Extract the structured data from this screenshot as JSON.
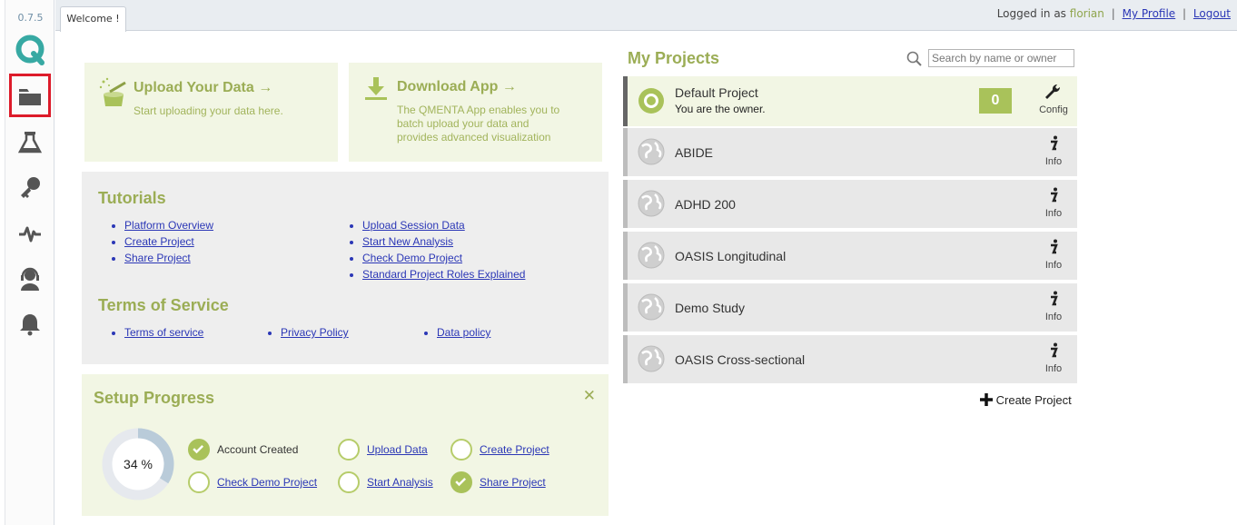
{
  "app": {
    "version": "0.7.5",
    "tab_label": "Welcome !",
    "accent": "#9bad55"
  },
  "userbar": {
    "logged_in_prefix": "Logged in as",
    "username": "florian",
    "my_profile": "My Profile",
    "logout": "Logout",
    "sep": "|"
  },
  "sidebar": {
    "items": [
      {
        "name": "projects",
        "icon": "folder-icon",
        "active": true
      },
      {
        "name": "analysis",
        "icon": "flask-icon"
      },
      {
        "name": "keys",
        "icon": "key-icon"
      },
      {
        "name": "activity",
        "icon": "pulse-icon"
      },
      {
        "name": "support",
        "icon": "headset-icon"
      },
      {
        "name": "notifications",
        "icon": "bell-icon"
      }
    ]
  },
  "upload": {
    "title": "Upload Your Data →",
    "subtitle": "Start uploading your data here."
  },
  "download": {
    "title": "Download App →",
    "lines": [
      "The QMENTA App enables you to",
      "batch upload your data and",
      "provides advanced visualization"
    ]
  },
  "tutorials": {
    "title": "Tutorials",
    "left": [
      "Platform Overview",
      "Create Project",
      "Share Project"
    ],
    "right": [
      "Upload Session Data",
      "Start New Analysis",
      "Check Demo Project",
      "Standard Project Roles Explained"
    ]
  },
  "terms": {
    "title": "Terms of Service",
    "links": [
      "Terms of service",
      "Privacy Policy",
      "Data policy"
    ]
  },
  "setup": {
    "title": "Setup Progress",
    "close": "✕",
    "progress": 34,
    "progress_label": "34 %",
    "items": [
      {
        "label": "Account Created",
        "done": true,
        "link": false
      },
      {
        "label": "Upload Data",
        "done": false,
        "link": true
      },
      {
        "label": "Create Project",
        "done": false,
        "link": true
      },
      {
        "label": "Check Demo Project",
        "done": false,
        "link": true
      },
      {
        "label": "Start Analysis",
        "done": false,
        "link": true
      },
      {
        "label": "Share Project",
        "done": true,
        "link": true
      }
    ]
  },
  "projects": {
    "title": "My Projects",
    "search_placeholder": "Search by name or owner",
    "list": [
      {
        "name": "Default Project",
        "sub": "You are the owner.",
        "count": "0",
        "action": "Config",
        "active": true
      },
      {
        "name": "ABIDE",
        "action": "Info"
      },
      {
        "name": "ADHD 200",
        "action": "Info"
      },
      {
        "name": "OASIS Longitudinal",
        "action": "Info"
      },
      {
        "name": "Demo Study",
        "action": "Info"
      },
      {
        "name": "OASIS Cross-sectional",
        "action": "Info"
      }
    ],
    "create_label": "Create Project"
  }
}
